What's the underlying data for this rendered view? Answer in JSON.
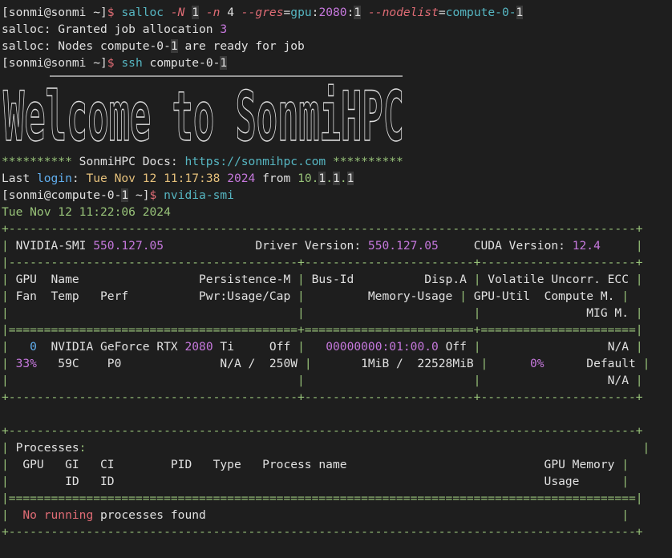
{
  "terminal": {
    "lines": [
      {
        "kind": "cmd",
        "segs": [
          [
            "w",
            "[sonmi@sonmi ~]"
          ],
          [
            "br",
            "$ "
          ],
          [
            "c",
            "salloc "
          ],
          [
            "pink",
            "-N "
          ],
          [
            "hl",
            "1"
          ],
          [
            "w",
            " "
          ],
          [
            "pink",
            "-n "
          ],
          [
            "w",
            "4 "
          ],
          [
            "pink",
            "--gres"
          ],
          [
            "w",
            "="
          ],
          [
            "c",
            "gpu"
          ],
          [
            "w",
            ":"
          ],
          [
            "m",
            "2080"
          ],
          [
            "w",
            ":"
          ],
          [
            "hl",
            "1"
          ],
          [
            "w",
            " "
          ],
          [
            "pink",
            "--nodelist"
          ],
          [
            "w",
            "="
          ],
          [
            "c",
            "compute-0-"
          ],
          [
            "hl",
            "1"
          ]
        ]
      },
      {
        "kind": "out",
        "segs": [
          [
            "w",
            "salloc: Granted job allocation "
          ],
          [
            "m",
            "3"
          ]
        ]
      },
      {
        "kind": "out",
        "segs": [
          [
            "w",
            "salloc: Nodes compute-0-"
          ],
          [
            "hl",
            "1"
          ],
          [
            "w",
            " are ready for job"
          ]
        ]
      },
      {
        "kind": "cmd",
        "segs": [
          [
            "w",
            "[sonmi@sonmi ~]"
          ],
          [
            "br",
            "$ "
          ],
          [
            "c",
            "ssh "
          ],
          [
            "w",
            "compute-0-"
          ],
          [
            "hl",
            "1"
          ]
        ]
      },
      {
        "kind": "logo",
        "text": "Welcome to SonmiHPC"
      },
      {
        "kind": "out",
        "segs": [
          [
            "g",
            "********** "
          ],
          [
            "w",
            "SonmiHPC Docs: "
          ],
          [
            "c",
            "https://sonmihpc.com"
          ],
          [
            "g",
            " **********"
          ]
        ]
      },
      {
        "kind": "out",
        "segs": [
          [
            "w",
            "Last "
          ],
          [
            "b",
            "login"
          ],
          [
            "w",
            ": "
          ],
          [
            "y",
            "Tue Nov 12 11:17:38 "
          ],
          [
            "m",
            "2024"
          ],
          [
            "w",
            " from "
          ],
          [
            "g",
            "10."
          ],
          [
            "hl",
            "1"
          ],
          [
            "g",
            "."
          ],
          [
            "hl",
            "1"
          ],
          [
            "g",
            "."
          ],
          [
            "hl",
            "1"
          ]
        ]
      },
      {
        "kind": "cmd",
        "segs": [
          [
            "w",
            "[sonmi@compute-0-"
          ],
          [
            "hl",
            "1"
          ],
          [
            "w",
            " ~]"
          ],
          [
            "br",
            "$ "
          ],
          [
            "c",
            "nvidia-smi"
          ]
        ]
      },
      {
        "kind": "out",
        "segs": [
          [
            "g",
            "Tue Nov 12 11:22:06 2024"
          ]
        ]
      },
      {
        "kind": "out",
        "segs": [
          [
            "g",
            "+-----------------------------------------------------------------------------------------+"
          ]
        ]
      },
      {
        "kind": "out",
        "segs": [
          [
            "g",
            "| "
          ],
          [
            "w",
            "NVIDIA-SMI "
          ],
          [
            "m",
            "550.127.05"
          ],
          [
            "w",
            "             Driver Version: "
          ],
          [
            "m",
            "550.127.05"
          ],
          [
            "w",
            "     CUDA Version: "
          ],
          [
            "m",
            "12.4"
          ],
          [
            "g",
            "     |"
          ]
        ]
      },
      {
        "kind": "out",
        "segs": [
          [
            "g",
            "|-----------------------------------------+------------------------+----------------------+"
          ]
        ]
      },
      {
        "kind": "out",
        "segs": [
          [
            "g",
            "| "
          ],
          [
            "w",
            "GPU  Name                 Persistence-M "
          ],
          [
            "g",
            "| "
          ],
          [
            "w",
            "Bus-Id          Disp.A "
          ],
          [
            "g",
            "| "
          ],
          [
            "w",
            "Volatile Uncorr. ECC "
          ],
          [
            "g",
            "|"
          ]
        ]
      },
      {
        "kind": "out",
        "segs": [
          [
            "g",
            "| "
          ],
          [
            "w",
            "Fan  Temp   Perf          Pwr:Usage/Cap "
          ],
          [
            "g",
            "| "
          ],
          [
            "w",
            "        Memory-Usage "
          ],
          [
            "g",
            "| "
          ],
          [
            "w",
            "GPU-Util  Compute M. "
          ],
          [
            "g",
            "|"
          ]
        ]
      },
      {
        "kind": "out",
        "segs": [
          [
            "g",
            "|                                         |                        |"
          ],
          [
            "w",
            "               MIG M. "
          ],
          [
            "g",
            "|"
          ]
        ]
      },
      {
        "kind": "out",
        "segs": [
          [
            "g",
            "|=========================================+========================+======================|"
          ]
        ]
      },
      {
        "kind": "out",
        "segs": [
          [
            "g",
            "|   "
          ],
          [
            "b",
            "0"
          ],
          [
            "w",
            "  NVIDIA GeForce RTX "
          ],
          [
            "m",
            "2080"
          ],
          [
            "w",
            " Ti     Off "
          ],
          [
            "g",
            "|   "
          ],
          [
            "m",
            "00000000:01:00.0"
          ],
          [
            "w",
            " Off "
          ],
          [
            "g",
            "|"
          ],
          [
            "w",
            "                  N/A "
          ],
          [
            "g",
            "|"
          ]
        ]
      },
      {
        "kind": "out",
        "segs": [
          [
            "g",
            "| "
          ],
          [
            "m",
            "33%"
          ],
          [
            "w",
            "   59C    P0              N/A /  250W "
          ],
          [
            "g",
            "|"
          ],
          [
            "w",
            "       1MiB /  22528MiB "
          ],
          [
            "g",
            "|"
          ],
          [
            "w",
            "      "
          ],
          [
            "m",
            "0%"
          ],
          [
            "w",
            "      Default "
          ],
          [
            "g",
            "|"
          ]
        ]
      },
      {
        "kind": "out",
        "segs": [
          [
            "g",
            "|                                         |                        |"
          ],
          [
            "w",
            "                  N/A "
          ],
          [
            "g",
            "|"
          ]
        ]
      },
      {
        "kind": "out",
        "segs": [
          [
            "g",
            "+-----------------------------------------+------------------------+----------------------+"
          ]
        ]
      },
      {
        "kind": "out",
        "segs": [
          [
            "w",
            " "
          ]
        ]
      },
      {
        "kind": "out",
        "segs": [
          [
            "g",
            "+-----------------------------------------------------------------------------------------+"
          ]
        ]
      },
      {
        "kind": "out",
        "segs": [
          [
            "g",
            "| "
          ],
          [
            "w",
            "Processes"
          ],
          [
            "g",
            ":"
          ],
          [
            "g",
            "                                                                               |"
          ]
        ]
      },
      {
        "kind": "out",
        "segs": [
          [
            "g",
            "| "
          ],
          [
            "w",
            " GPU   GI   CI        PID   Type   Process name                            GPU Memory "
          ],
          [
            "g",
            "|"
          ]
        ]
      },
      {
        "kind": "out",
        "segs": [
          [
            "g",
            "| "
          ],
          [
            "w",
            "       ID   ID                                                             Usage      "
          ],
          [
            "g",
            "|"
          ]
        ]
      },
      {
        "kind": "out",
        "segs": [
          [
            "g",
            "|=========================================================================================|"
          ]
        ]
      },
      {
        "kind": "out",
        "segs": [
          [
            "g",
            "| "
          ],
          [
            "r",
            " No running"
          ],
          [
            "w",
            " processes found"
          ],
          [
            "g",
            "                                                           |"
          ]
        ]
      },
      {
        "kind": "out",
        "segs": [
          [
            "g",
            "+-----------------------------------------------------------------------------------------+"
          ]
        ]
      }
    ]
  }
}
